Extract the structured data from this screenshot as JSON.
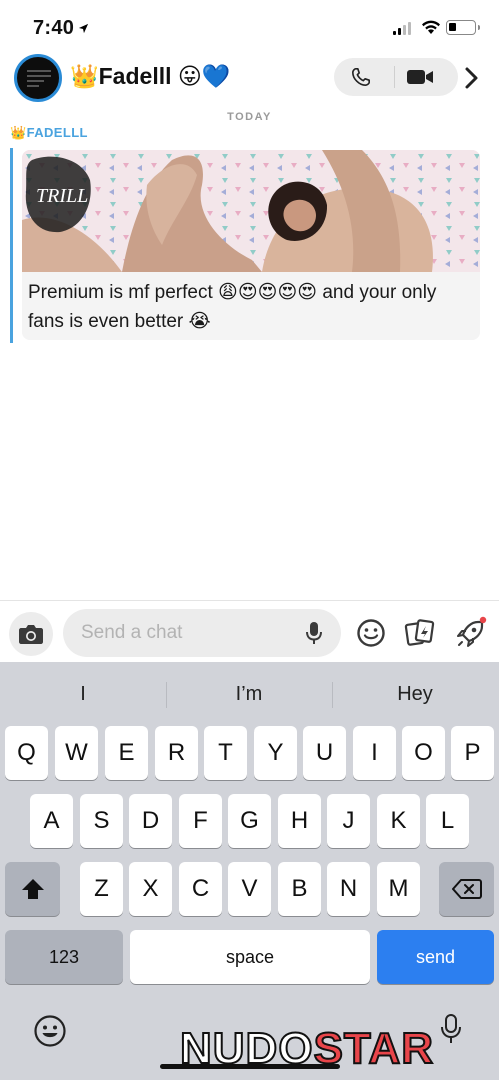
{
  "status_bar": {
    "time": "7:40"
  },
  "chat_header": {
    "title": "👑Fadelll 😛💙",
    "icons": [
      "phone-icon",
      "video-camera-icon",
      "chevron-right-icon"
    ]
  },
  "conversation": {
    "date_label": "TODAY",
    "messages": [
      {
        "sender": "👑FADELLL",
        "media_watermark": "TRILL",
        "caption": "Premium is mf perfect 😩😍😍😍😍 and your only fans is even better 😭"
      }
    ]
  },
  "input_bar": {
    "placeholder": "Send a chat",
    "icons": [
      "camera-icon",
      "microphone-icon",
      "smiley-icon",
      "cards-icon",
      "rocket-icon"
    ]
  },
  "keyboard": {
    "suggestions": [
      "I",
      "I’m",
      "Hey"
    ],
    "row1": [
      "Q",
      "W",
      "E",
      "R",
      "T",
      "Y",
      "U",
      "I",
      "O",
      "P"
    ],
    "row2": [
      "A",
      "S",
      "D",
      "F",
      "G",
      "H",
      "J",
      "K",
      "L"
    ],
    "row3": [
      "Z",
      "X",
      "C",
      "V",
      "B",
      "N",
      "M"
    ],
    "numbers_label": "123",
    "space_label": "space",
    "send_label": "send",
    "icons": [
      "shift-icon",
      "backspace-icon",
      "emoji-icon",
      "dictation-icon"
    ]
  },
  "watermark": {
    "part1": "NUDO",
    "part2": "STAR"
  },
  "colors": {
    "accent_blue": "#4aa3df",
    "send_key": "#2c7ff0",
    "keyboard_bg": "#d1d3d9"
  }
}
